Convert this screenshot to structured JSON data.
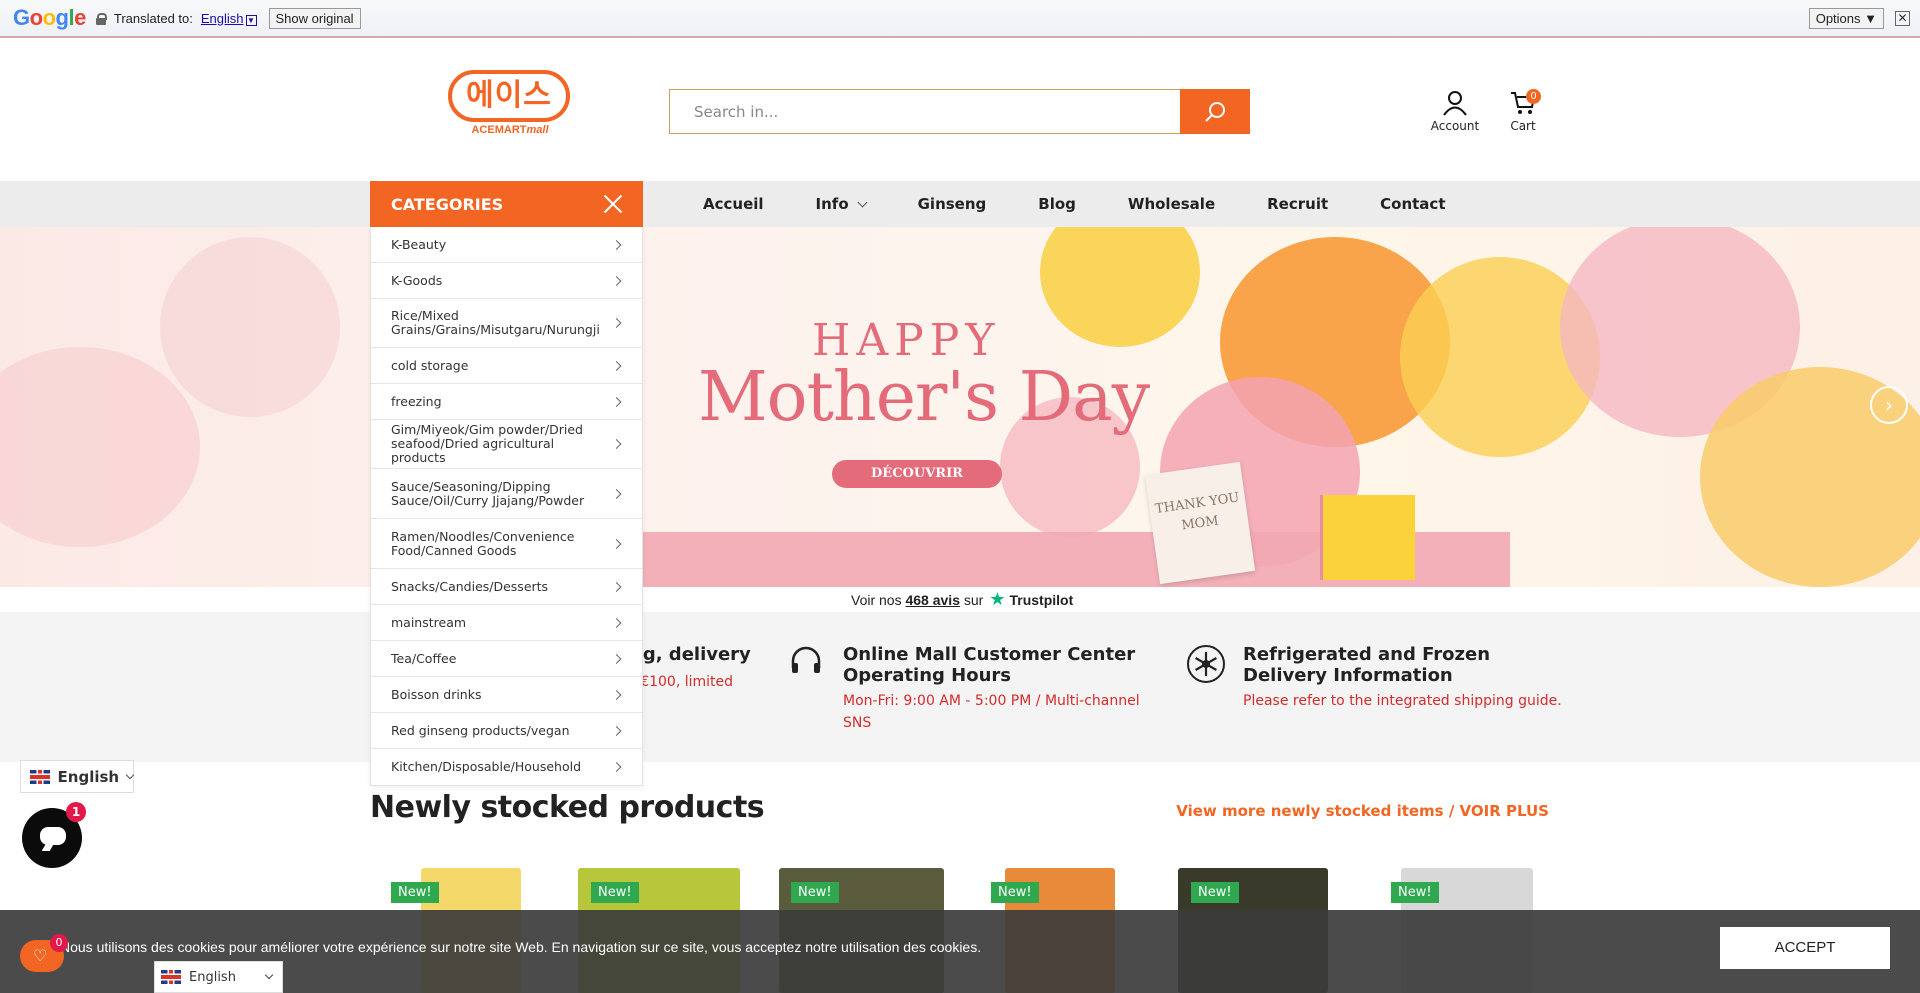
{
  "translate_bar": {
    "logo": "Google",
    "translated_to_label": "Translated to:",
    "language": "English",
    "show_original": "Show original",
    "options": "Options ▼",
    "close": "✕"
  },
  "header": {
    "logo_korean": "에이스",
    "logo_english": "ACEMART",
    "logo_english_suffix": "mall",
    "search_placeholder": "Search in...",
    "account_label": "Account",
    "cart_label": "Cart",
    "cart_count": "0"
  },
  "nav": {
    "categories_label": "CATEGORIES",
    "items": [
      "Accueil",
      "Info",
      "Ginseng",
      "Blog",
      "Wholesale",
      "Recruit",
      "Contact"
    ]
  },
  "categories": [
    "K-Beauty",
    "K-Goods",
    "Rice/Mixed Grains/Grains/Misutgaru/Nurungji",
    "cold storage",
    "freezing",
    "Gim/Miyeok/Gim powder/Dried seafood/Dried agricultural products",
    "Sauce/Seasoning/Dipping Sauce/Oil/Curry Jjajang/Powder",
    "Ramen/Noodles/Convenience Food/Canned Goods",
    "Snacks/Candies/Desserts",
    "mainstream",
    "Tea/Coffee",
    "Boisson drinks",
    "Red ginseng products/vegan",
    "Kitchen/Disposable/Household"
  ],
  "hero": {
    "line1": "HAPPY",
    "line2": "Mother's Day",
    "button": "DÉCOUVRIR",
    "card_text": "THANK YOU MOM"
  },
  "trustpilot": {
    "prefix": "Voir nos",
    "count": "468 avis",
    "middle": "sur",
    "brand": "Trustpilot"
  },
  "info_strip": [
    {
      "title": "ng, delivery",
      "text": "r €100, limited"
    },
    {
      "title": "Online Mall Customer Center Operating Hours",
      "text": "Mon-Fri: 9:00 AM - 5:00 PM / Multi-channel SNS"
    },
    {
      "title": "Refrigerated and Frozen Delivery Information",
      "text": "Please refer to the integrated shipping guide."
    }
  ],
  "language_selector": {
    "label": "English"
  },
  "section": {
    "title": "Newly stocked products",
    "more_link": "View more newly stocked items / VOIR PLUS"
  },
  "products": [
    {
      "badge": "New!",
      "color": "#f4d96a"
    },
    {
      "badge": "New!",
      "color": "#b7c63a"
    },
    {
      "badge": "New!",
      "color": "#5a5a3c"
    },
    {
      "badge": "New!",
      "color": "#e88a3a"
    },
    {
      "badge": "New!",
      "color": "#3a3a2a"
    },
    {
      "badge": "New!",
      "color": "#d8d8d8"
    }
  ],
  "chat": {
    "badge": "1"
  },
  "cookie": {
    "text": "Nous utilisons des cookies pour améliorer votre expérience sur notre site Web. En navigation sur ce site, vous acceptez notre utilisation des cookies.",
    "accept": "ACCEPT"
  },
  "wishlist": {
    "count": "0"
  },
  "language_selector_bottom": {
    "label": "English"
  },
  "colors": {
    "brand": "#f26522",
    "status_red": "#d62b2b",
    "new_badge": "#2fa84f"
  }
}
